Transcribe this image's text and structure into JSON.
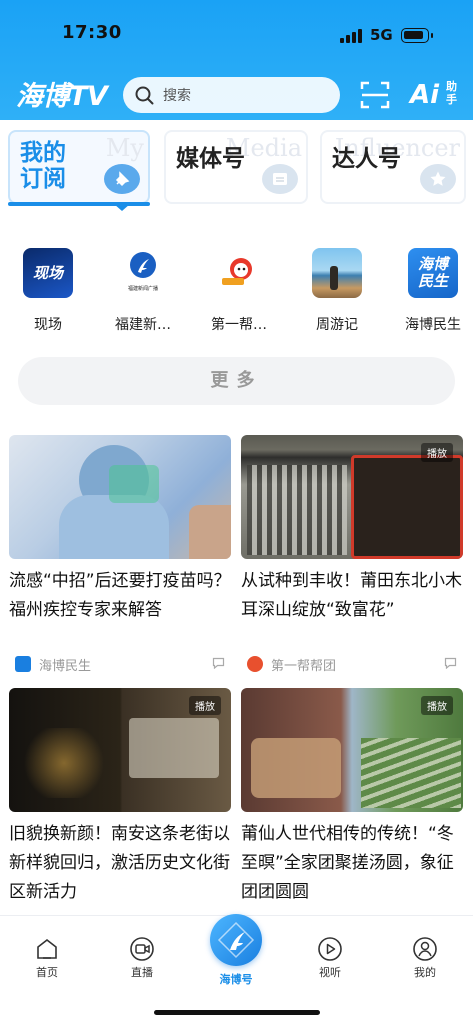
{
  "status_bar": {
    "time": "17:30",
    "network": "5G"
  },
  "header": {
    "logo": "海博TV",
    "search": {
      "placeholder": "搜索"
    },
    "ai_label": "助手",
    "ai_letter": "Ai"
  },
  "tabs": [
    {
      "label": "我的订阅",
      "ghost": "My",
      "active": true
    },
    {
      "label": "媒体号",
      "ghost": "Media",
      "active": false
    },
    {
      "label": "达人号",
      "ghost": "Influencer",
      "active": false
    }
  ],
  "channels": [
    {
      "name": "现场",
      "thumb_text": "现场"
    },
    {
      "name": "福建新…",
      "thumb_text": "福建新闻广播"
    },
    {
      "name": "第一帮…",
      "thumb_text": ""
    },
    {
      "name": "周游记",
      "thumb_text": ""
    },
    {
      "name": "海博民生",
      "thumb_text": "海博民生"
    }
  ],
  "more_label": "更多",
  "articles": [
    {
      "title": "流感“中招”后还要打疫苗吗？福州疾控专家来解答",
      "source": "海博民生",
      "video": false
    },
    {
      "title": "从试种到丰收！莆田东北小木耳深山绽放“致富花”",
      "source": "第一帮帮团",
      "video": true,
      "play_label": "播放"
    },
    {
      "title": "旧貌换新颜！南安这条老街以新样貌回归，激活历史文化街区新活力",
      "source": "",
      "video": true,
      "play_label": "播放"
    },
    {
      "title": "莆仙人世代相传的传统！“冬至暝”全家团聚搓汤圆，象征团团圆圆",
      "source": "",
      "video": true,
      "play_label": "播放"
    }
  ],
  "bottom_nav": [
    {
      "label": "首页",
      "icon": "home-icon"
    },
    {
      "label": "直播",
      "icon": "live-icon"
    },
    {
      "label": "海博号",
      "icon": "haibo-icon",
      "active": true
    },
    {
      "label": "视听",
      "icon": "play-icon"
    },
    {
      "label": "我的",
      "icon": "profile-icon"
    }
  ],
  "colors": {
    "brand": "#1aa2f5",
    "accent": "#1a8ee8"
  }
}
